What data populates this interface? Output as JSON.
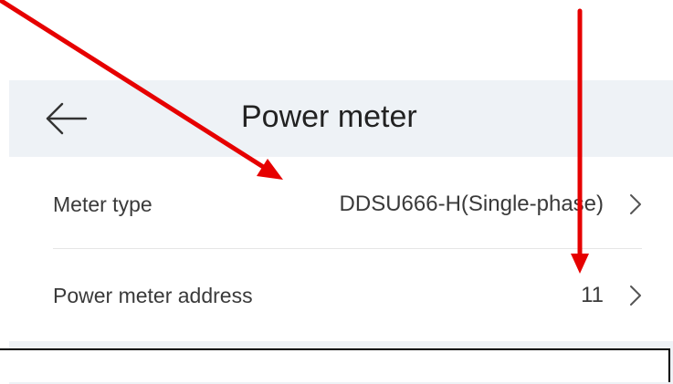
{
  "header": {
    "title": "Power meter",
    "back_icon": "arrow-left-icon"
  },
  "rows": [
    {
      "label": "Meter type",
      "value": "DDSU666-H(Single-phase)",
      "icon": "chevron-right-icon"
    },
    {
      "label": "Power meter address",
      "value": "11",
      "icon": "chevron-right-icon"
    }
  ],
  "annotation": {
    "arrow_color": "#e60000"
  }
}
